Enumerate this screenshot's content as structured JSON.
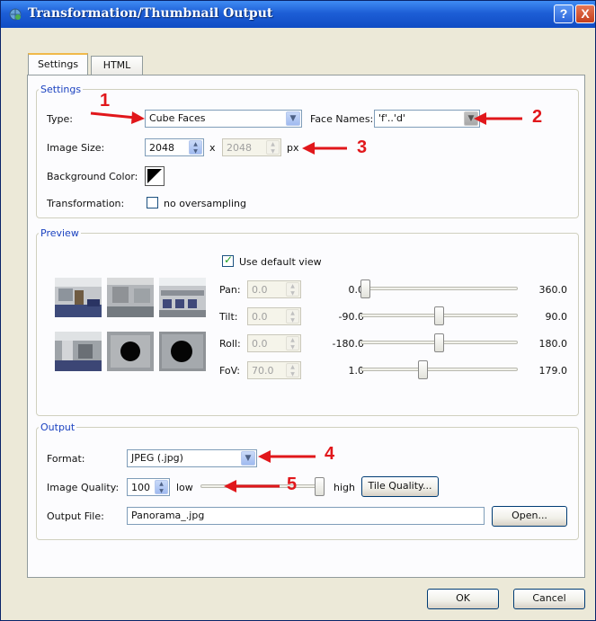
{
  "window": {
    "title": "Transformation/Thumbnail Output"
  },
  "titlebar": {
    "help_label": "?",
    "close_label": "X"
  },
  "tabs": [
    {
      "label": "Settings",
      "active": true
    },
    {
      "label": "HTML",
      "active": false
    }
  ],
  "settings": {
    "legend": "Settings",
    "type_label": "Type:",
    "type_value": "Cube Faces",
    "face_names_label": "Face Names:",
    "face_names_value": "'f'..'d'",
    "image_size_label": "Image Size:",
    "width_value": "2048",
    "x_label": "x",
    "height_value": "2048",
    "unit_label": "px",
    "bg_color_label": "Background Color:",
    "transformation_label": "Transformation:",
    "oversampling_label": "no oversampling",
    "oversampling_checked": false
  },
  "preview": {
    "legend": "Preview",
    "use_default_label": "Use default view",
    "use_default_checked": true,
    "rows": [
      {
        "label": "Pan:",
        "value": "0.0",
        "min": "0.0",
        "max": "360.0",
        "level": 0.0
      },
      {
        "label": "Tilt:",
        "value": "0.0",
        "min": "-90.0",
        "max": "90.0",
        "level": 0.5
      },
      {
        "label": "Roll:",
        "value": "0.0",
        "min": "-180.0",
        "max": "180.0",
        "level": 0.5
      },
      {
        "label": "FoV:",
        "value": "70.0",
        "min": "1.0",
        "max": "179.0",
        "level": 0.388
      }
    ],
    "thumbnails": [
      "front-face",
      "right-face",
      "back-face",
      "left-face",
      "up-face",
      "down-face"
    ]
  },
  "output": {
    "legend": "Output",
    "format_label": "Format:",
    "format_value": "JPEG (.jpg)",
    "quality_label": "Image Quality:",
    "quality_value": "100",
    "low_label": "low",
    "high_label": "high",
    "quality_level": 1.0,
    "tile_quality_label": "Tile Quality...",
    "output_file_label": "Output File:",
    "output_file_value": "Panorama_.jpg",
    "open_label": "Open..."
  },
  "buttons": {
    "ok_label": "OK",
    "cancel_label": "Cancel"
  },
  "annotations": {
    "n1": "1",
    "n2": "2",
    "n3": "3",
    "n4": "4",
    "n5": "5",
    "color": "#e1171b"
  },
  "colors": {
    "titlebar": "#1d5ed6",
    "legend_text": "#1c43c0",
    "dialog_bg": "#ece9d8"
  }
}
